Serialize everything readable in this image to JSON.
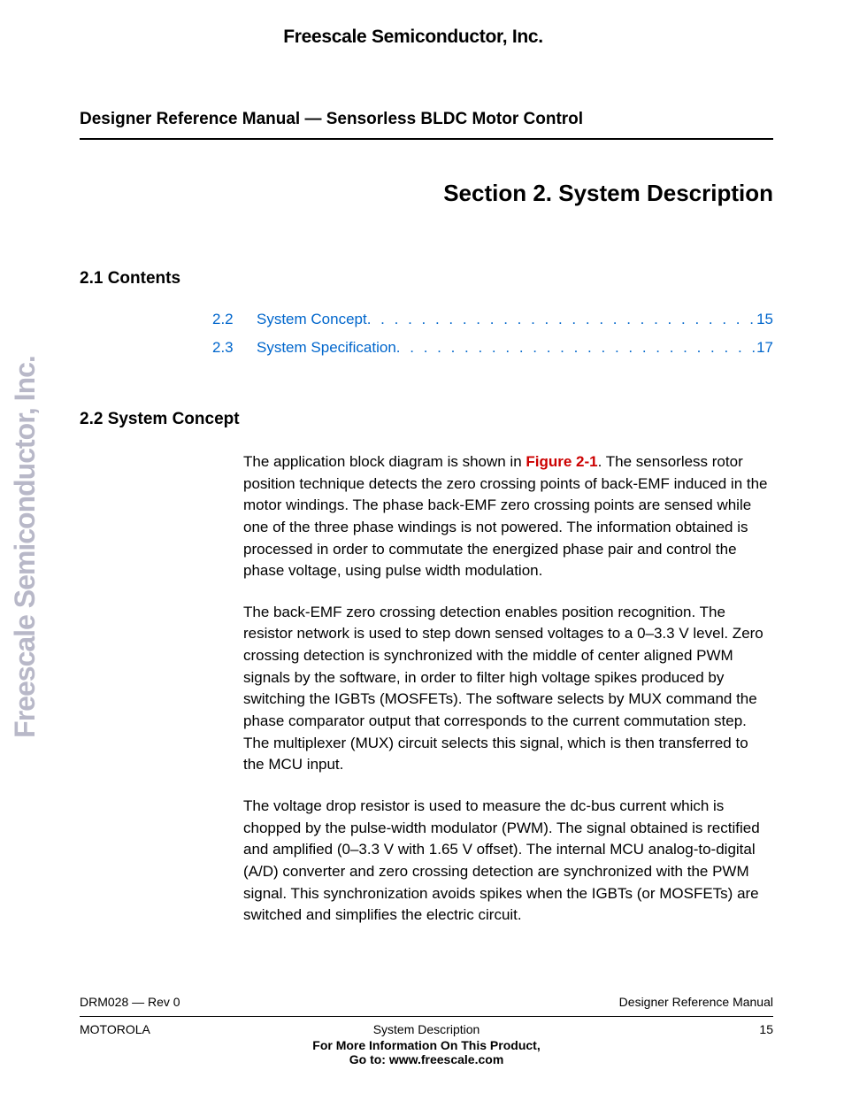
{
  "header": {
    "company": "Freescale Semiconductor, Inc."
  },
  "doc_title": "Designer Reference Manual — Sensorless BLDC Motor Control",
  "section_title": "Section 2. System Description",
  "contents_heading": "2.1  Contents",
  "toc": [
    {
      "number": "2.2",
      "label": "System Concept",
      "page": "15"
    },
    {
      "number": "2.3",
      "label": "System Specification",
      "page": "17"
    }
  ],
  "system_concept_heading": "2.2  System Concept",
  "figure_ref": "Figure 2-1",
  "para1_a": "The application block diagram is shown in ",
  "para1_b": ". The sensorless rotor position technique detects the zero crossing points of back-EMF induced in the motor windings. The phase back-EMF zero crossing points are sensed while one of the three phase windings is not powered. The information obtained is processed in order to commutate the energized phase pair and control the phase voltage, using pulse width modulation.",
  "para2": "The back-EMF zero crossing detection enables position recognition. The resistor network is used to step down sensed voltages to a 0–3.3 V level. Zero crossing detection is synchronized with the middle of center aligned PWM signals by the software, in order to filter high voltage spikes produced by switching the IGBTs (MOSFETs). The software selects by MUX command the phase comparator output that corresponds to the current commutation step. The multiplexer (MUX) circuit selects this signal, which is then transferred to the MCU input.",
  "para3": "The voltage drop resistor is used to measure the dc-bus current which is chopped by the pulse-width modulator (PWM). The signal obtained is rectified and amplified (0–3.3 V with 1.65 V offset). The internal MCU analog-to-digital (A/D) converter and zero crossing detection are synchronized with the PWM signal. This synchronization avoids spikes when the IGBTs (or MOSFETs) are switched and simplifies the electric circuit.",
  "side_label": "Freescale Semiconductor, Inc.",
  "footer": {
    "doc_id": "DRM028 — Rev 0",
    "manual_type": "Designer Reference Manual",
    "vendor": "MOTOROLA",
    "chapter": "System Description",
    "page_num": "15",
    "more_info_line1": "For More Information On This Product,",
    "more_info_line2": "Go to: www.freescale.com"
  }
}
